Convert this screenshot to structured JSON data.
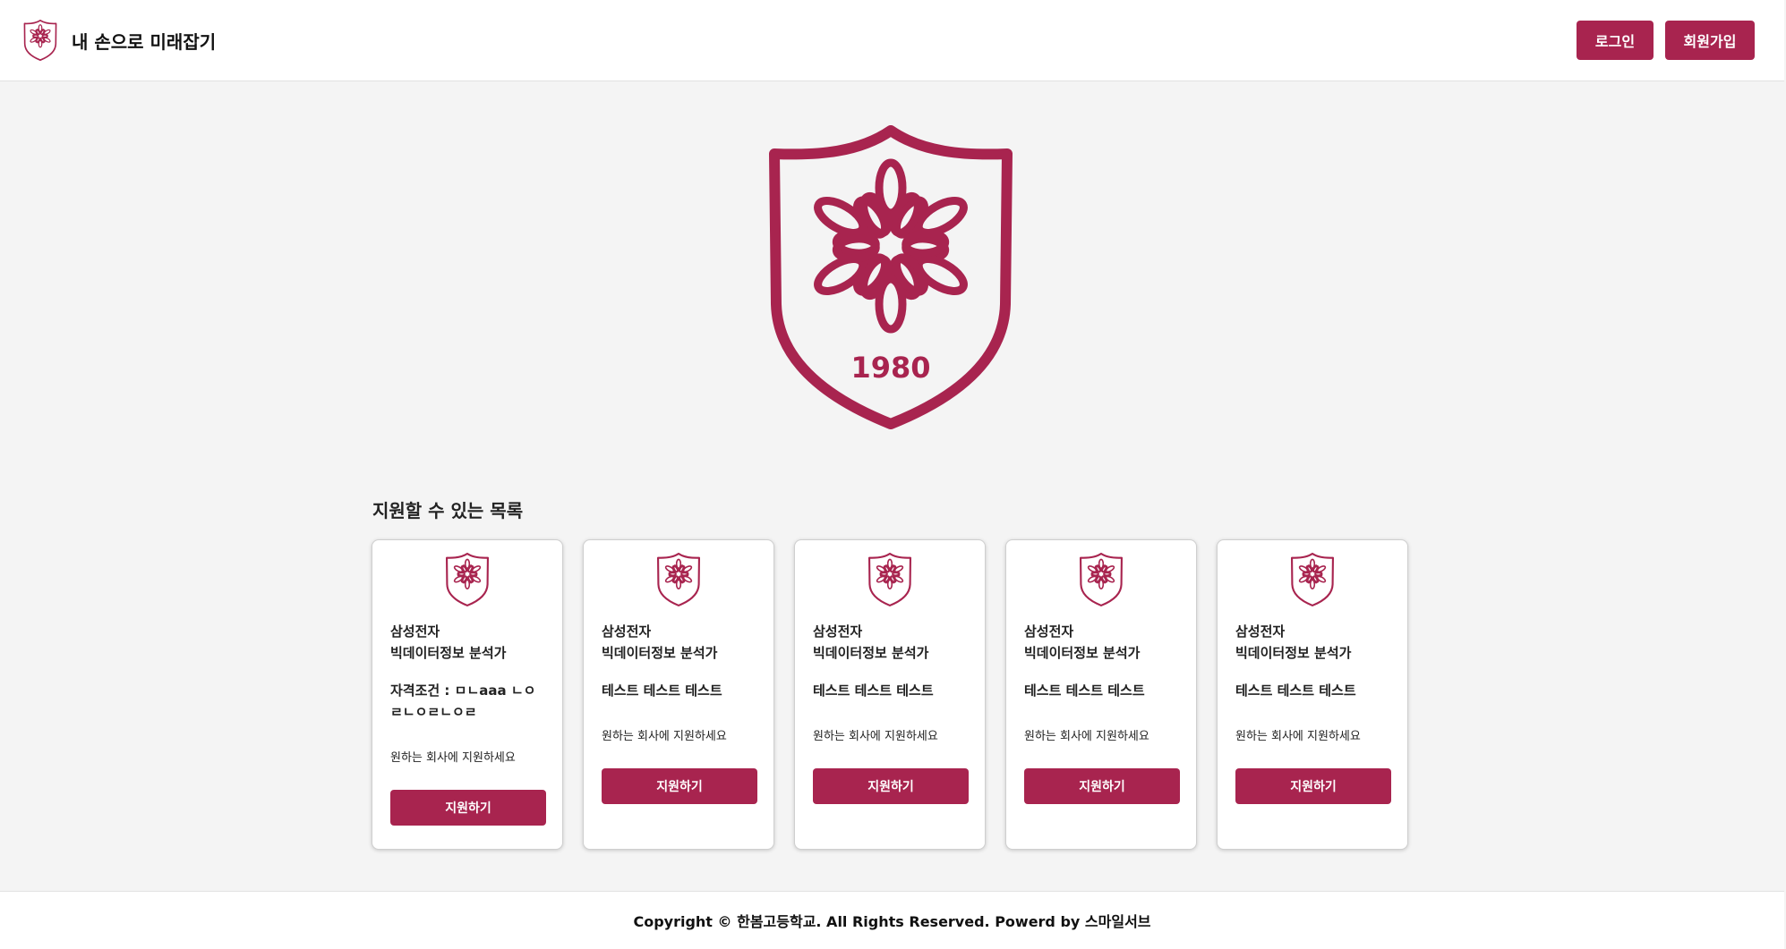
{
  "header": {
    "title": "내 손으로 미래잡기",
    "login_label": "로그인",
    "signup_label": "회원가입"
  },
  "hero": {
    "year": "1980"
  },
  "colors": {
    "brand": "#a8244f",
    "background": "#f4f4f4"
  },
  "section": {
    "title": "지원할 수 있는 목록"
  },
  "cards": [
    {
      "company": "삼성전자",
      "job": "빅데이터정보 분석가",
      "desc": "자격조건 : ㅁㄴaaa ㄴㅇㄹㄴㅇㄹㄴㅇㄹ",
      "sub": "원하는 회사에 지원하세요",
      "button": "지원하기"
    },
    {
      "company": "삼성전자",
      "job": "빅데이터정보 분석가",
      "desc": "테스트 테스트 테스트",
      "sub": "원하는 회사에 지원하세요",
      "button": "지원하기"
    },
    {
      "company": "삼성전자",
      "job": "빅데이터정보 분석가",
      "desc": "테스트 테스트 테스트",
      "sub": "원하는 회사에 지원하세요",
      "button": "지원하기"
    },
    {
      "company": "삼성전자",
      "job": "빅데이터정보 분석가",
      "desc": "테스트 테스트 테스트",
      "sub": "원하는 회사에 지원하세요",
      "button": "지원하기"
    },
    {
      "company": "삼성전자",
      "job": "빅데이터정보 분석가",
      "desc": "테스트 테스트 테스트",
      "sub": "원하는 회사에 지원하세요",
      "button": "지원하기"
    }
  ],
  "footer": {
    "text": "Copyright © 한봄고등학교. All Rights Reserved. Powerd by 스마일서브"
  }
}
